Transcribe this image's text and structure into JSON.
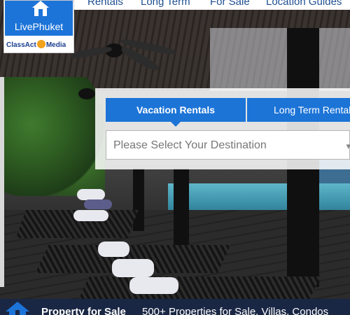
{
  "nav": {
    "items": [
      "Rentals",
      "Long Term",
      "For Sale",
      "Location Guides"
    ]
  },
  "logo": {
    "name": "LivePhuket",
    "partner_prefix": "ClassAct",
    "partner_suffix": "Media"
  },
  "search": {
    "tabs": [
      {
        "label": "Vacation Rentals",
        "active": true
      },
      {
        "label": "Long Term Rentals",
        "active": false
      }
    ],
    "destination_placeholder": "Please Select Your Destination"
  },
  "promo": {
    "title": "Property for Sale",
    "description": "500+ Properties for Sale, Villas, Condos"
  },
  "colors": {
    "accent": "#1c74d7",
    "bottom_bar": "#1a2744",
    "nav_text": "#1e4f91"
  }
}
